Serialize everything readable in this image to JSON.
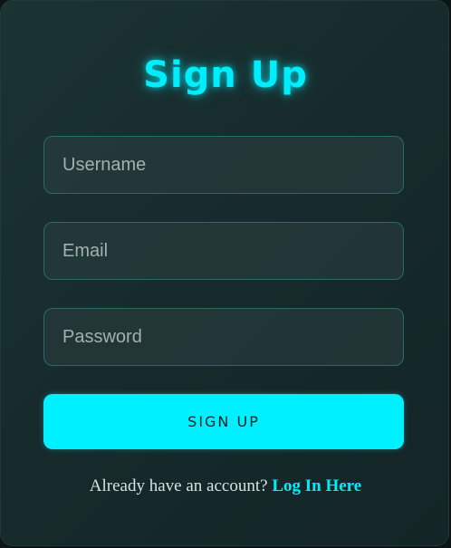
{
  "form": {
    "title": "Sign Up",
    "username_placeholder": "Username",
    "email_placeholder": "Email",
    "password_placeholder": "Password",
    "submit_label": "SIGN UP",
    "footer_text": "Already have an account?",
    "login_link": "Log In Here"
  },
  "colors": {
    "accent": "#00f0ff",
    "background": "#1a2f30",
    "field_border": "#2a6a6c"
  }
}
